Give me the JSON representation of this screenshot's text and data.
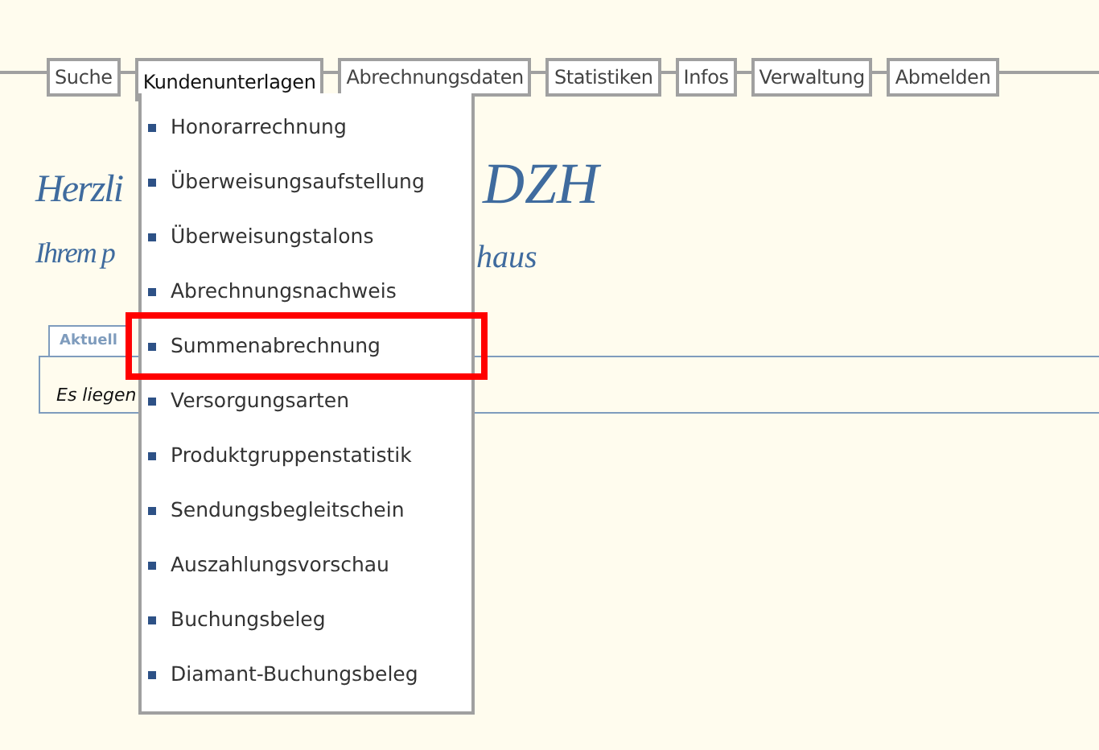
{
  "nav": [
    {
      "label": "Suche",
      "selected": false
    },
    {
      "label": "Kundenunterlagen",
      "selected": true
    },
    {
      "label": "Abrechnungsdaten",
      "selected": false
    },
    {
      "label": "Statistiken",
      "selected": false
    },
    {
      "label": "Infos",
      "selected": false
    },
    {
      "label": "Verwaltung",
      "selected": false
    },
    {
      "label": "Abmelden",
      "selected": false
    }
  ],
  "menu": [
    {
      "label": "Honorarrechnung",
      "highlighted": false
    },
    {
      "label": "Überweisungsaufstellung",
      "highlighted": false
    },
    {
      "label": "Überweisungstalons",
      "highlighted": false
    },
    {
      "label": "Abrechnungsnachweis",
      "highlighted": false
    },
    {
      "label": "Summenabrechnung",
      "highlighted": true
    },
    {
      "label": "Versorgungsarten",
      "highlighted": false
    },
    {
      "label": "Produktgruppenstatistik",
      "highlighted": false
    },
    {
      "label": "Sendungsbegleitschein",
      "highlighted": false
    },
    {
      "label": "Auszahlungsvorschau",
      "highlighted": false
    },
    {
      "label": "Buchungsbeleg",
      "highlighted": false
    },
    {
      "label": "Diamant-Buchungsbeleg",
      "highlighted": false
    }
  ],
  "greeting": {
    "line_1_start": "Herzli",
    "line_1_end": "DZH",
    "line_2_start": "Ihrem p",
    "line_2_end": "haus"
  },
  "tabs": [
    {
      "label": "Aktuell",
      "selected": true
    }
  ],
  "panel_text": "Es liegen"
}
